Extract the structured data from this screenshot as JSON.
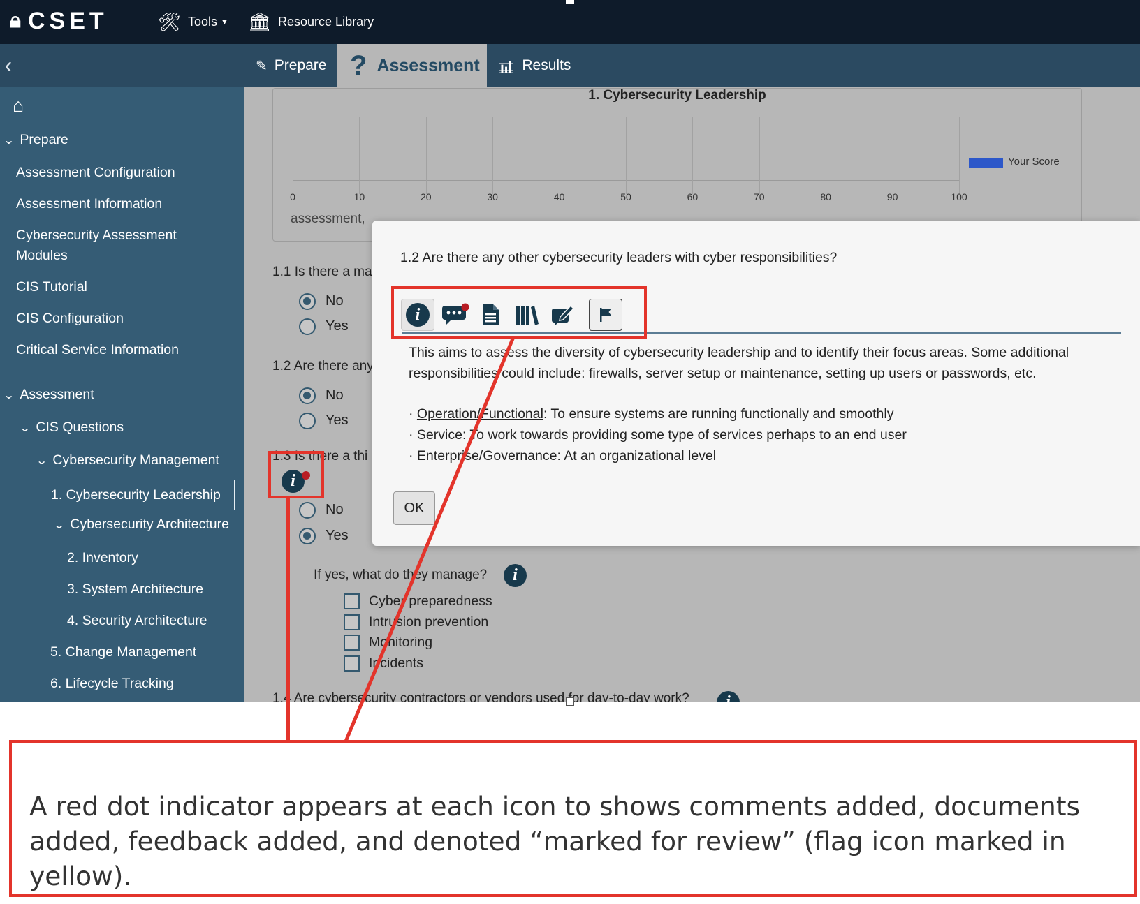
{
  "app": {
    "logo": "CSET"
  },
  "topnav": {
    "tools": "Tools",
    "resource_library": "Resource Library"
  },
  "tabs": {
    "prepare": "Prepare",
    "assessment": "Assessment",
    "results": "Results"
  },
  "sidebar": {
    "prepare_header": "Prepare",
    "prepare_items": [
      "Assessment Configuration",
      "Assessment Information",
      "Cybersecurity Assessment",
      "Modules",
      "CIS Tutorial",
      "CIS Configuration",
      "Critical Service Information"
    ],
    "assessment_header": "Assessment",
    "cis_questions": "CIS Questions",
    "cyber_mgmt": "Cybersecurity Management",
    "active_item": "1. Cybersecurity Leadership",
    "cyber_arch": "Cybersecurity Architecture",
    "sub_items": [
      "2. Inventory",
      "3. System Architecture",
      "4. Security Architecture"
    ],
    "items_after": [
      "5. Change Management",
      "6. Lifecycle Tracking"
    ]
  },
  "chart_data": {
    "type": "bar",
    "title": "1. Cybersecurity Leadership",
    "categories": [],
    "series": [
      {
        "name": "Your Score",
        "values": []
      }
    ],
    "xlim": [
      0,
      100
    ],
    "x_ticks": [
      "0",
      "10",
      "20",
      "30",
      "40",
      "50",
      "60",
      "70",
      "80",
      "90",
      "100"
    ],
    "legend": "right",
    "colors": {
      "your_score": "#2c57c9"
    }
  },
  "main": {
    "behind_text": "assessment,",
    "q1": "1.1 Is there a ma",
    "q2": "1.2 Are there any",
    "q3": "1.3 Is there a thi",
    "q4": "1.4 Are cybersecurity contractors or vendors used for day-to-day work?",
    "no": "No",
    "yes": "Yes",
    "followup": "If yes, what do they manage?",
    "checkboxes": [
      "Cyber preparedness",
      "Intrusion prevention",
      "Monitoring",
      "Incidents"
    ]
  },
  "dialog": {
    "question": "1.2 Are there any other cybersecurity leaders with cyber responsibilities?",
    "body_intro": "This aims to assess the diversity of cybersecurity leadership and to identify their focus areas. Some additional responsibilities could include: firewalls, server setup or maintenance, setting up users or passwords, etc.",
    "bullets": [
      {
        "term": "Operation/Functional",
        "text": ": To ensure systems are running functionally and smoothly"
      },
      {
        "term": "Service",
        "text": ": To work towards providing some type of services perhaps to an end user"
      },
      {
        "term": "Enterprise/Governance",
        "text": ": At an organizational level"
      }
    ],
    "bullet_mark": "·",
    "ok": "OK"
  },
  "annotation": {
    "text": "A red dot indicator appears at each icon to shows comments added, documents added, feedback added, and denoted “marked for review” (flag icon marked in yellow)."
  },
  "icons": {
    "tools": "wrench-screwdriver-icon",
    "library": "bank-icon",
    "home": "home-icon",
    "info": "info-icon",
    "comments": "comments-icon",
    "document": "document-icon",
    "references": "books-icon",
    "feedback": "feedback-edit-icon",
    "flag": "flag-icon"
  },
  "colors": {
    "topbar": "#0e1b2a",
    "tabbar": "#2b4a61",
    "sidebar": "#355c75",
    "overlay_gray": "#b7b7b7",
    "annotation_red": "#e3342b",
    "red_dot": "#b81d24"
  }
}
